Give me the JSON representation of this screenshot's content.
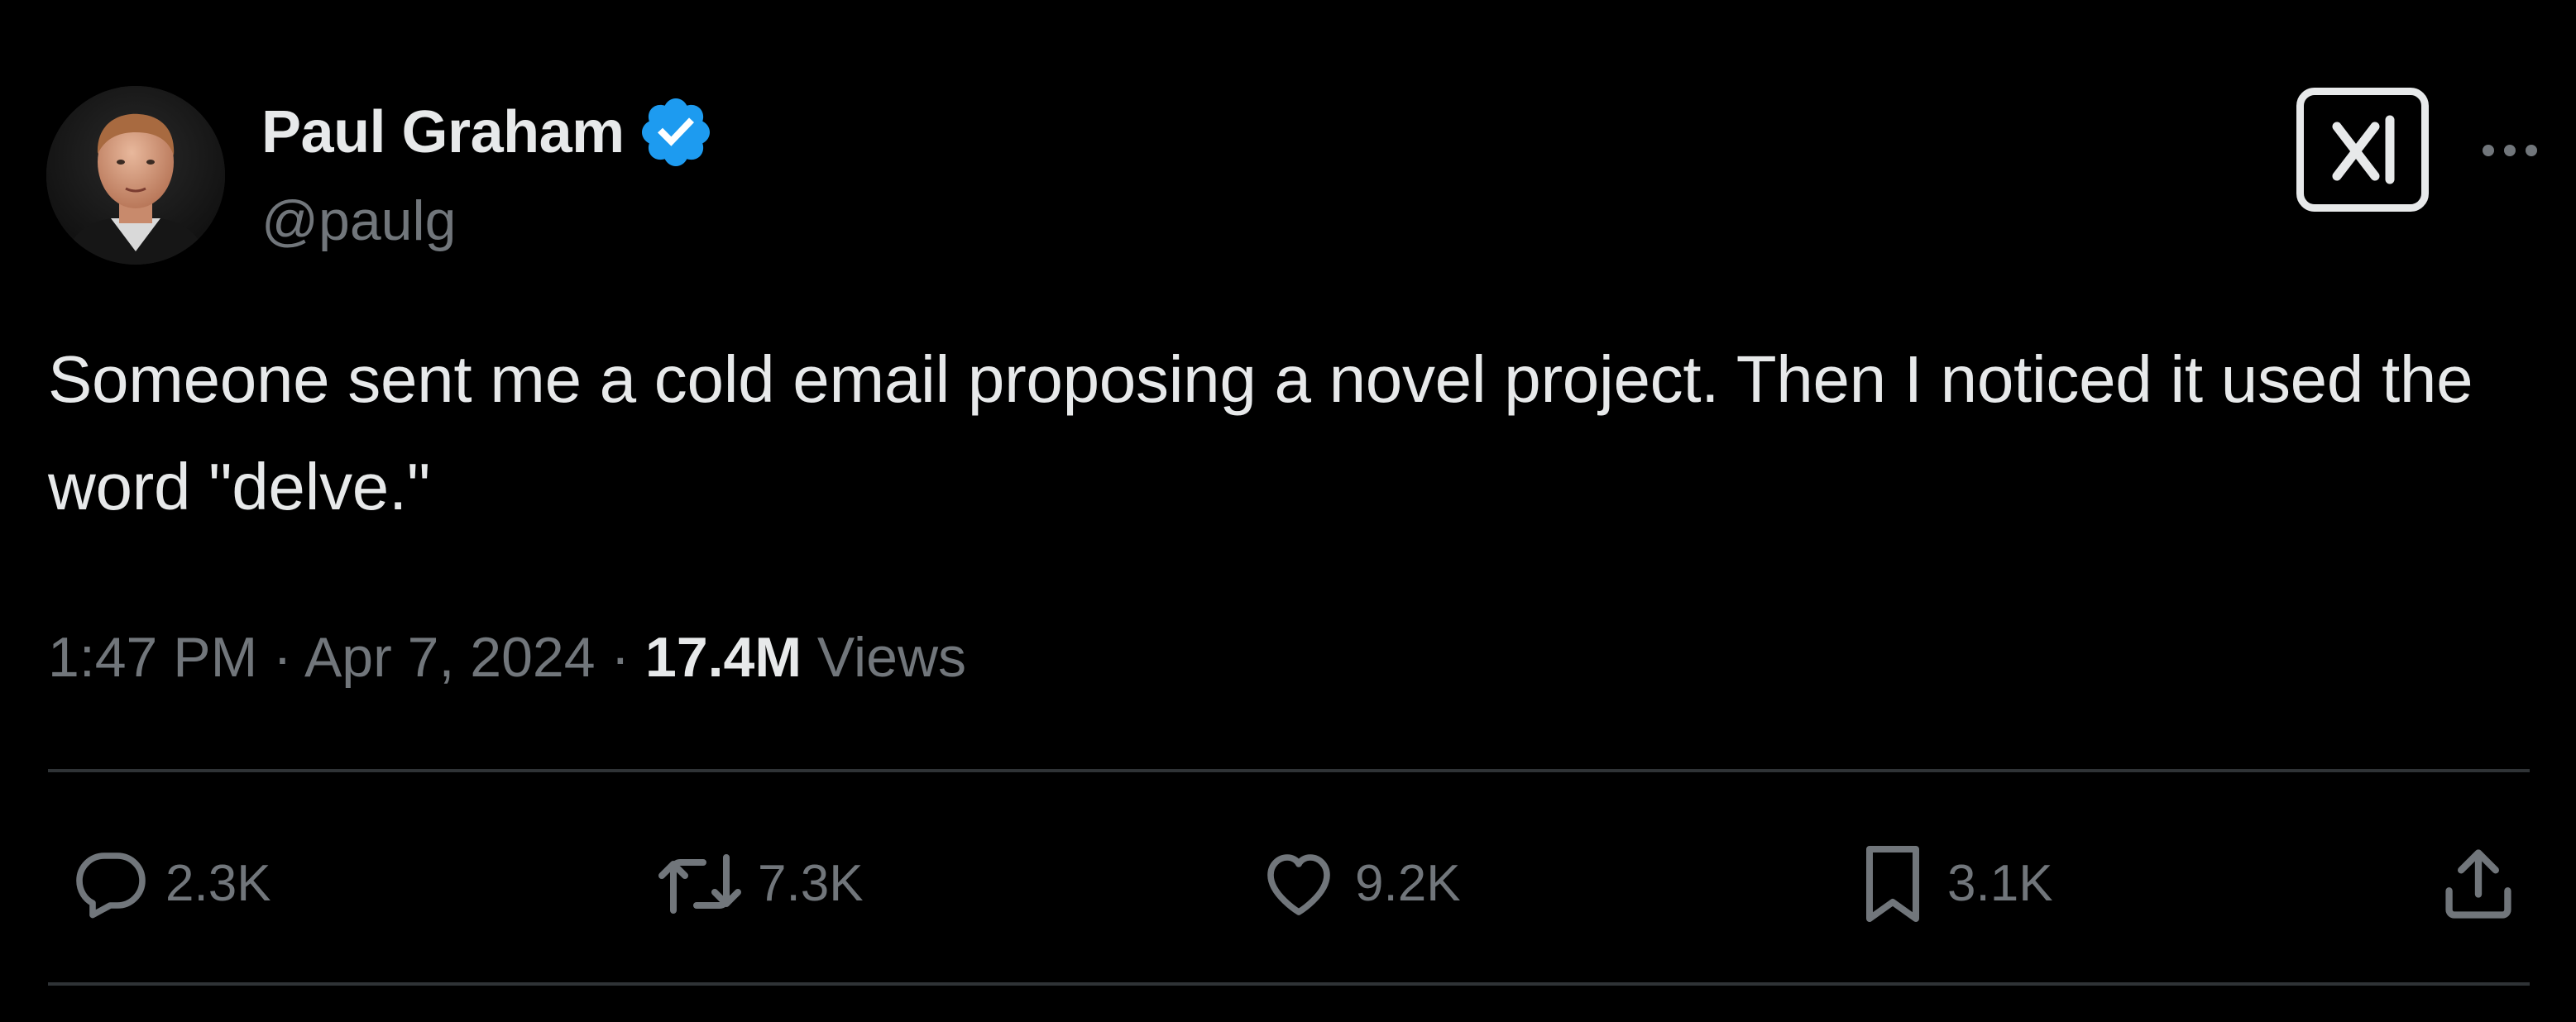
{
  "author": {
    "display_name": "Paul Graham",
    "handle": "@paulg",
    "verified": true,
    "verified_color": "#1d9bf0",
    "avatar_icon": "profile-photo"
  },
  "header_actions": {
    "grok_icon": "grok-icon",
    "more_icon": "more-icon"
  },
  "tweet": {
    "text": "Someone sent me a cold email proposing a novel project. Then I noticed it used the word \"delve.\""
  },
  "meta": {
    "time": "1:47 PM",
    "separator": "·",
    "date": "Apr 7, 2024",
    "views_count": "17.4M",
    "views_label": "Views"
  },
  "actions": {
    "reply": {
      "icon": "reply-icon",
      "count": "2.3K"
    },
    "retweet": {
      "icon": "retweet-icon",
      "count": "7.3K"
    },
    "like": {
      "icon": "heart-icon",
      "count": "9.2K"
    },
    "bookmark": {
      "icon": "bookmark-icon",
      "count": "3.1K"
    },
    "share": {
      "icon": "share-icon"
    }
  },
  "colors": {
    "background": "#000000",
    "text_primary": "#e7e9ea",
    "text_secondary": "#71767b",
    "divider": "#2f3336",
    "verified": "#1d9bf0"
  }
}
